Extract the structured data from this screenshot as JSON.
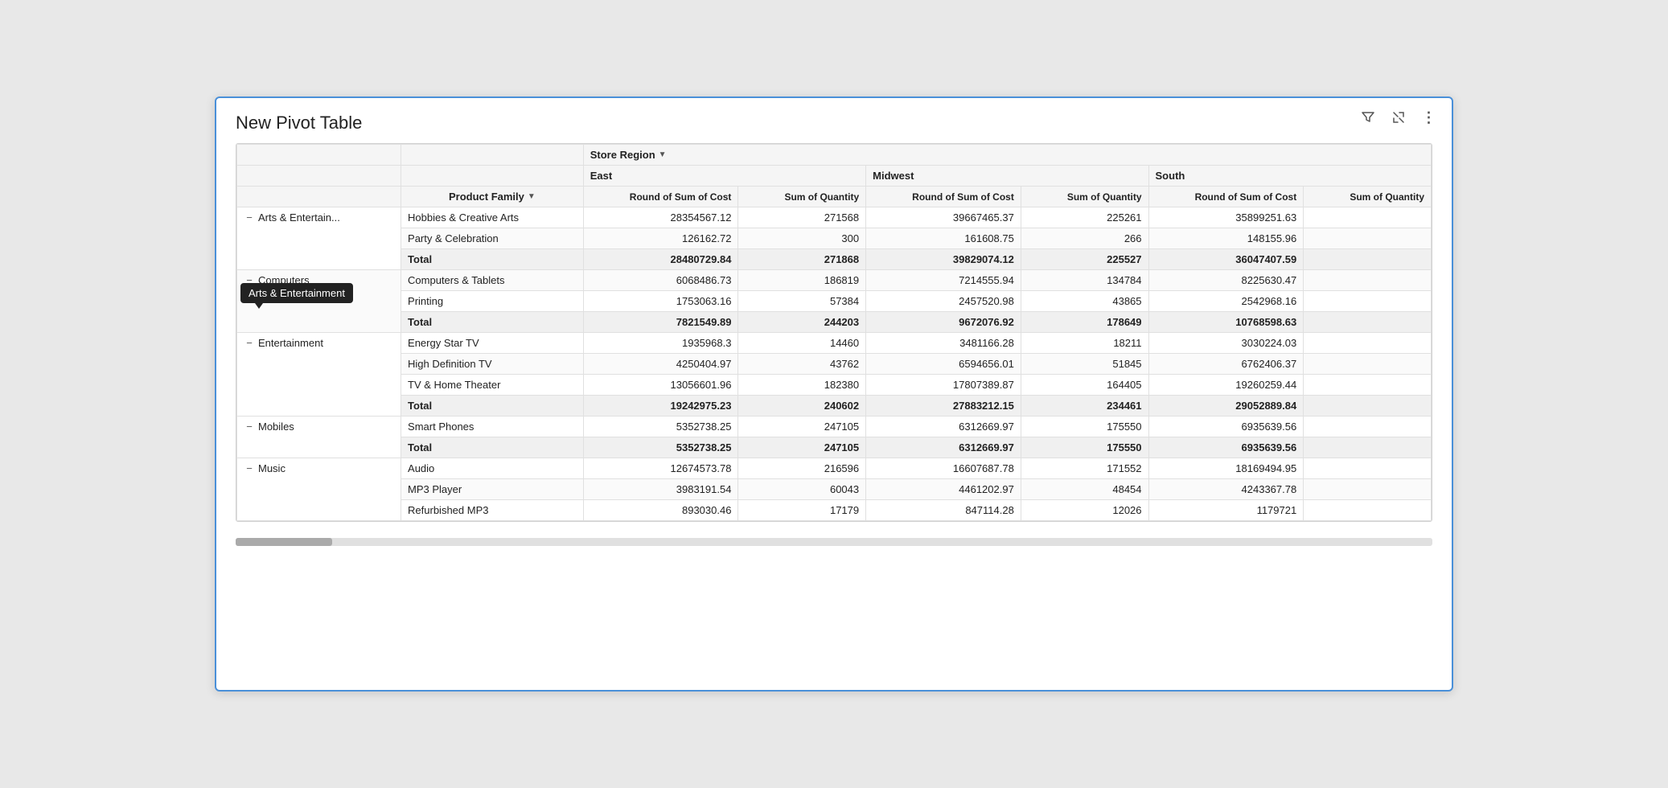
{
  "window": {
    "title": "New Pivot Table"
  },
  "toolbar": {
    "filter_icon": "⊲",
    "expand_icon": "⤢",
    "more_icon": "⋮"
  },
  "tooltip": {
    "text": "Arts & Entertainment"
  },
  "table": {
    "store_region_label": "Store Region",
    "regions": [
      "East",
      "Midwest",
      "South"
    ],
    "measures": [
      "Round of Sum of Cost",
      "Sum of Quantity"
    ],
    "product_family_label": "Product Family",
    "rows": [
      {
        "category": "Arts & Entertain...",
        "category_full": "Arts & Entertainment",
        "collapsed": false,
        "children": [
          {
            "product_family": "Hobbies & Creative Arts",
            "east_cost": "28354567.12",
            "east_qty": "271568",
            "midwest_cost": "39667465.37",
            "midwest_qty": "225261",
            "south_cost": "35899251.63"
          },
          {
            "product_family": "Party & Celebration",
            "east_cost": "126162.72",
            "east_qty": "300",
            "midwest_cost": "161608.75",
            "midwest_qty": "266",
            "south_cost": "148155.96"
          }
        ],
        "total": {
          "label": "Total",
          "east_cost": "28480729.84",
          "east_qty": "271868",
          "midwest_cost": "39829074.12",
          "midwest_qty": "225527",
          "south_cost": "36047407.59"
        }
      },
      {
        "category": "Computers",
        "collapsed": false,
        "children": [
          {
            "product_family": "Computers & Tablets",
            "east_cost": "6068486.73",
            "east_qty": "186819",
            "midwest_cost": "7214555.94",
            "midwest_qty": "134784",
            "south_cost": "8225630.47"
          },
          {
            "product_family": "Printing",
            "east_cost": "1753063.16",
            "east_qty": "57384",
            "midwest_cost": "2457520.98",
            "midwest_qty": "43865",
            "south_cost": "2542968.16"
          }
        ],
        "total": {
          "label": "Total",
          "east_cost": "7821549.89",
          "east_qty": "244203",
          "midwest_cost": "9672076.92",
          "midwest_qty": "178649",
          "south_cost": "10768598.63"
        }
      },
      {
        "category": "Entertainment",
        "collapsed": false,
        "children": [
          {
            "product_family": "Energy Star TV",
            "east_cost": "1935968.3",
            "east_qty": "14460",
            "midwest_cost": "3481166.28",
            "midwest_qty": "18211",
            "south_cost": "3030224.03"
          },
          {
            "product_family": "High Definition TV",
            "east_cost": "4250404.97",
            "east_qty": "43762",
            "midwest_cost": "6594656.01",
            "midwest_qty": "51845",
            "south_cost": "6762406.37"
          },
          {
            "product_family": "TV & Home Theater",
            "east_cost": "13056601.96",
            "east_qty": "182380",
            "midwest_cost": "17807389.87",
            "midwest_qty": "164405",
            "south_cost": "19260259.44"
          }
        ],
        "total": {
          "label": "Total",
          "east_cost": "19242975.23",
          "east_qty": "240602",
          "midwest_cost": "27883212.15",
          "midwest_qty": "234461",
          "south_cost": "29052889.84"
        }
      },
      {
        "category": "Mobiles",
        "collapsed": false,
        "children": [
          {
            "product_family": "Smart Phones",
            "east_cost": "5352738.25",
            "east_qty": "247105",
            "midwest_cost": "6312669.97",
            "midwest_qty": "175550",
            "south_cost": "6935639.56"
          }
        ],
        "total": {
          "label": "Total",
          "east_cost": "5352738.25",
          "east_qty": "247105",
          "midwest_cost": "6312669.97",
          "midwest_qty": "175550",
          "south_cost": "6935639.56"
        }
      },
      {
        "category": "Music",
        "collapsed": false,
        "children": [
          {
            "product_family": "Audio",
            "east_cost": "12674573.78",
            "east_qty": "216596",
            "midwest_cost": "16607687.78",
            "midwest_qty": "171552",
            "south_cost": "18169494.95"
          },
          {
            "product_family": "MP3 Player",
            "east_cost": "3983191.54",
            "east_qty": "60043",
            "midwest_cost": "4461202.97",
            "midwest_qty": "48454",
            "south_cost": "4243367.78"
          },
          {
            "product_family": "Refurbished MP3",
            "east_cost": "893030.46",
            "east_qty": "17179",
            "midwest_cost": "847114.28",
            "midwest_qty": "12026",
            "south_cost": "1179721"
          }
        ]
      }
    ]
  }
}
